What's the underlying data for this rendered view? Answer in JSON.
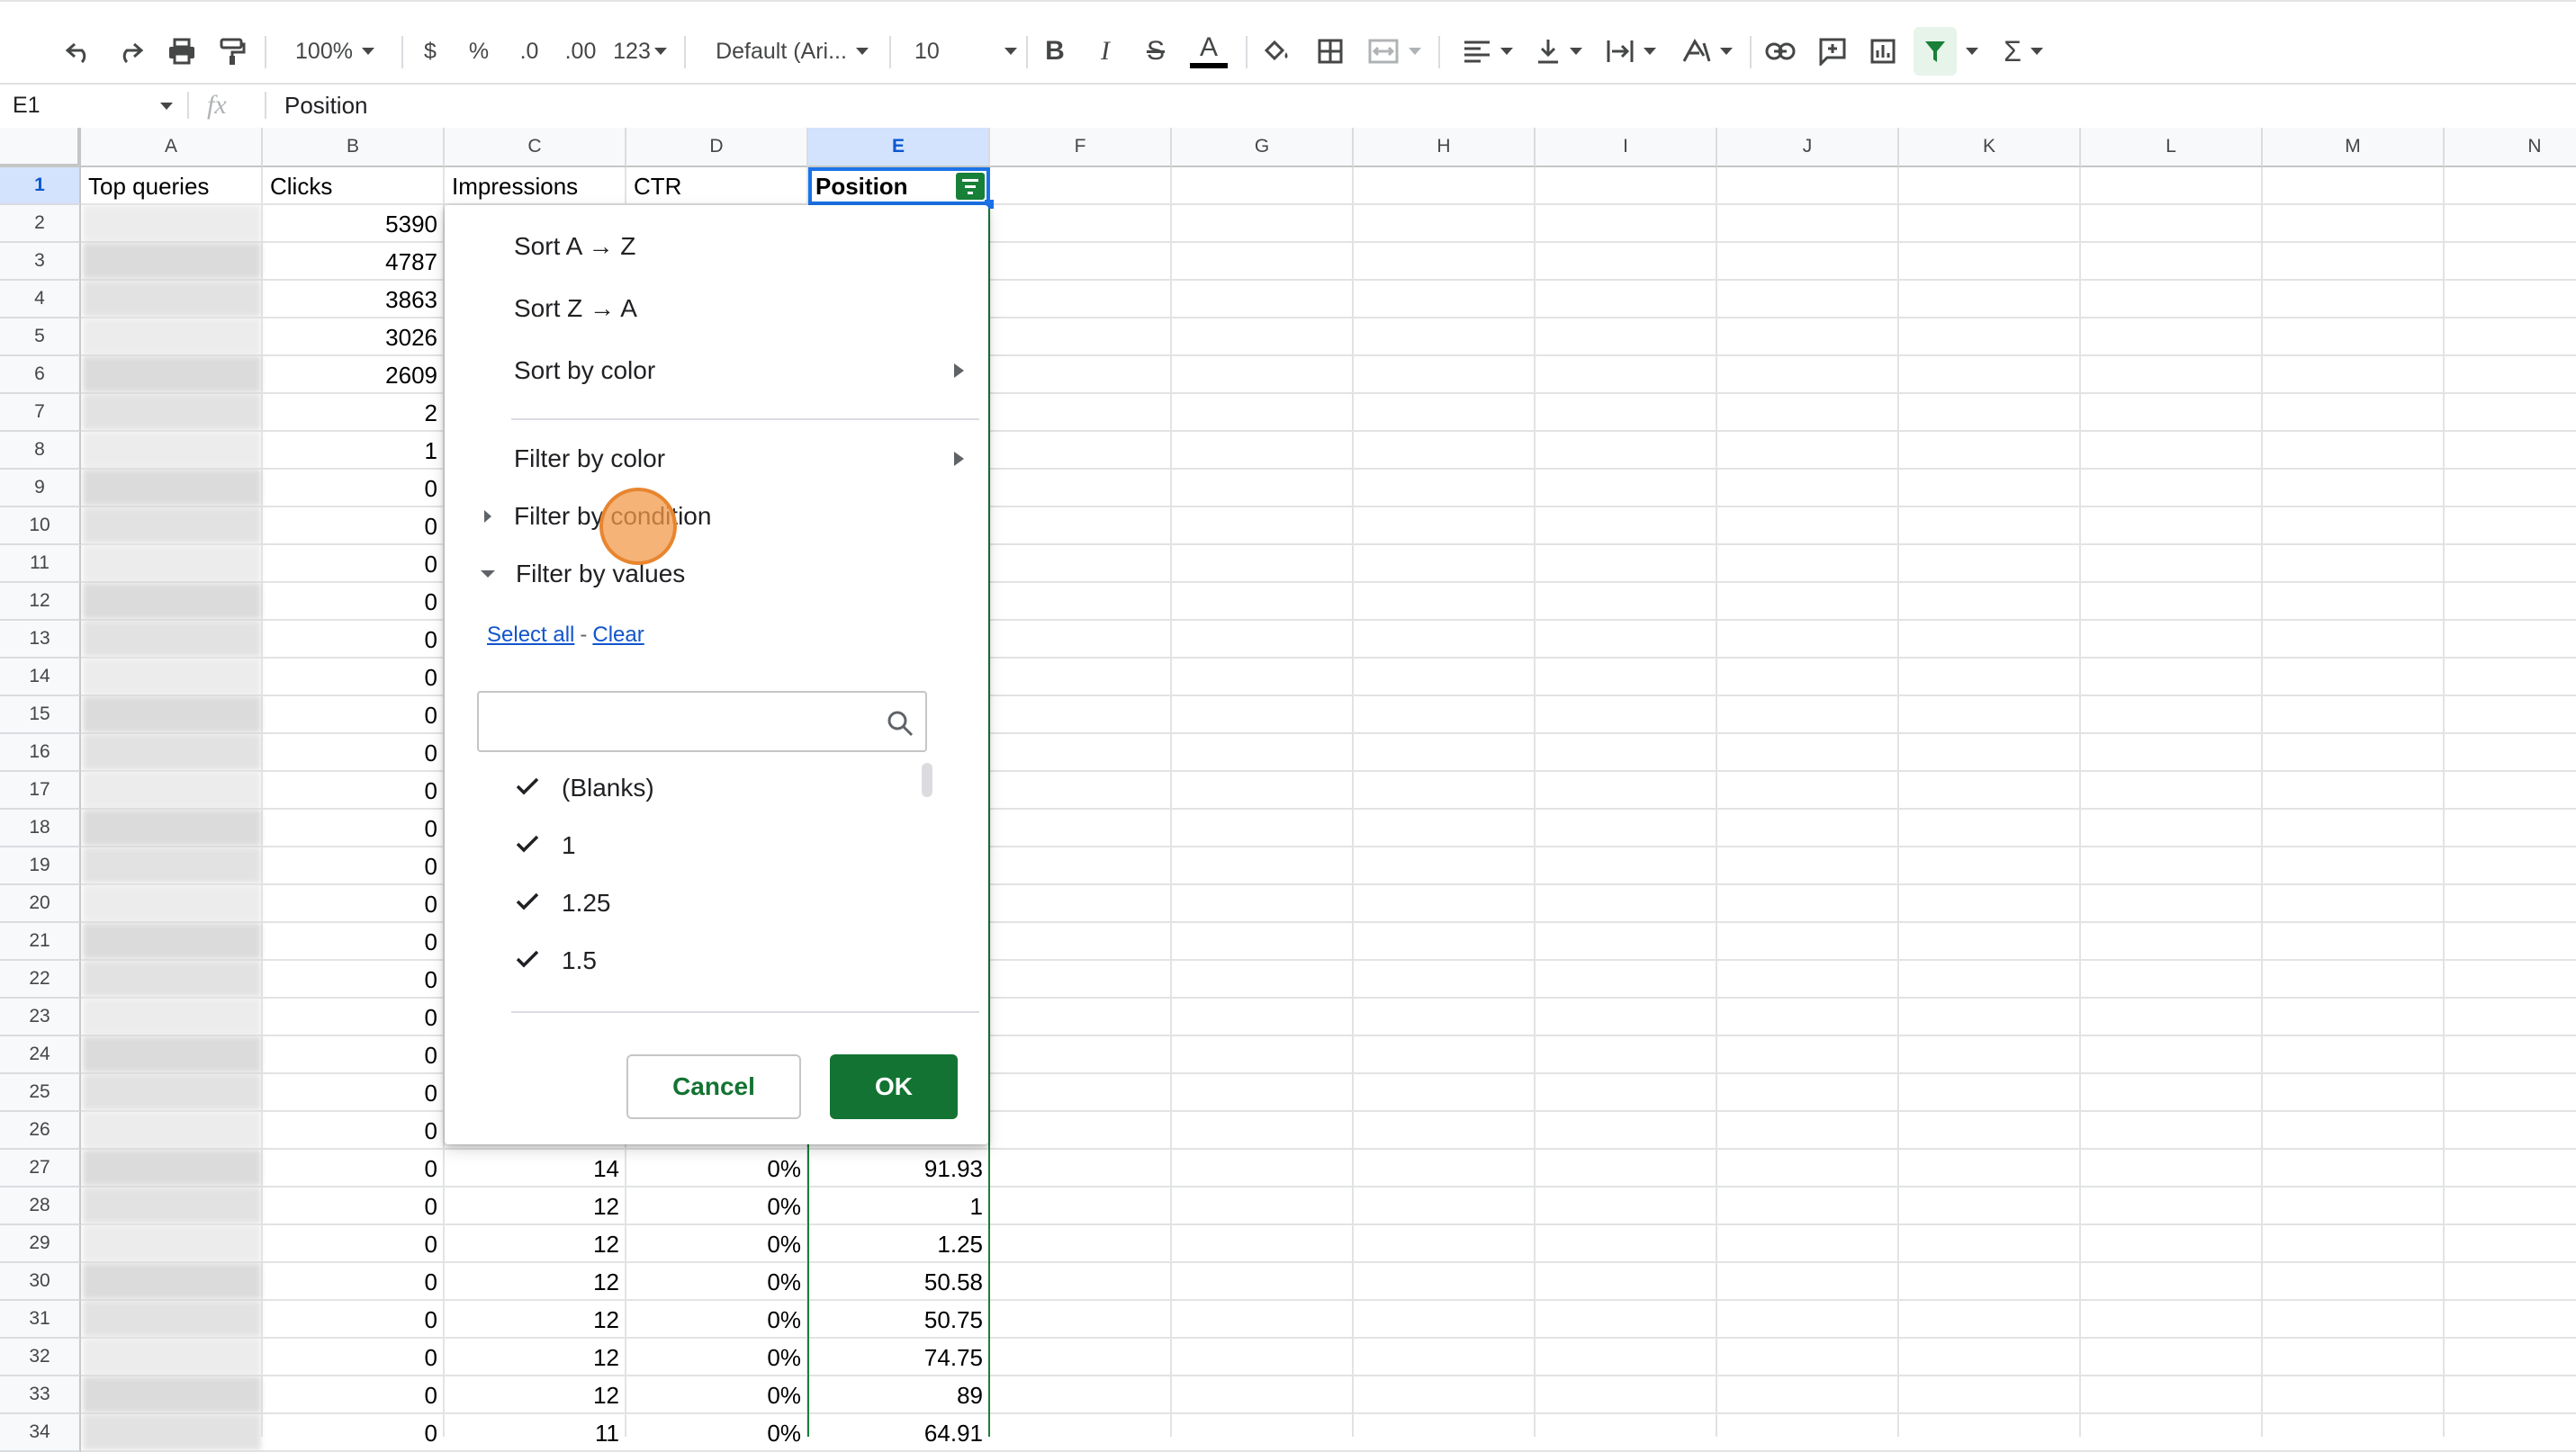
{
  "toolbar": {
    "zoom": "100%",
    "currency": "$",
    "percent": "%",
    "dec_decrease": ".0",
    "dec_increase": ".00",
    "format_more": "123",
    "font": "Default (Ari...",
    "font_size": "10",
    "bold": "B",
    "italic": "I",
    "strike": "S",
    "text_color": "A",
    "sum": "Σ"
  },
  "formula_bar": {
    "name_box": "E1",
    "fx": "fx",
    "content": "Position"
  },
  "columns": [
    "A",
    "B",
    "C",
    "D",
    "E",
    "F",
    "G",
    "H",
    "I",
    "J",
    "K",
    "L",
    "M",
    "N"
  ],
  "headers": {
    "a": "Top queries",
    "b": "Clicks",
    "c": "Impressions",
    "d": "CTR",
    "e": "Position"
  },
  "rows": [
    {
      "n": "1"
    },
    {
      "n": "2",
      "b": "5390"
    },
    {
      "n": "3",
      "b": "4787"
    },
    {
      "n": "4",
      "b": "3863"
    },
    {
      "n": "5",
      "b": "3026"
    },
    {
      "n": "6",
      "b": "2609"
    },
    {
      "n": "7",
      "b": "2"
    },
    {
      "n": "8",
      "b": "1"
    },
    {
      "n": "9",
      "b": "0"
    },
    {
      "n": "10",
      "b": "0"
    },
    {
      "n": "11",
      "b": "0"
    },
    {
      "n": "12",
      "b": "0"
    },
    {
      "n": "13",
      "b": "0"
    },
    {
      "n": "14",
      "b": "0"
    },
    {
      "n": "15",
      "b": "0"
    },
    {
      "n": "16",
      "b": "0"
    },
    {
      "n": "17",
      "b": "0"
    },
    {
      "n": "18",
      "b": "0"
    },
    {
      "n": "19",
      "b": "0"
    },
    {
      "n": "20",
      "b": "0"
    },
    {
      "n": "21",
      "b": "0"
    },
    {
      "n": "22",
      "b": "0"
    },
    {
      "n": "23",
      "b": "0"
    },
    {
      "n": "24",
      "b": "0"
    },
    {
      "n": "25",
      "b": "0"
    },
    {
      "n": "26",
      "b": "0"
    },
    {
      "n": "27",
      "b": "0",
      "c": "14",
      "d": "0%",
      "e": "91.93"
    },
    {
      "n": "28",
      "b": "0",
      "c": "12",
      "d": "0%",
      "e": "1"
    },
    {
      "n": "29",
      "b": "0",
      "c": "12",
      "d": "0%",
      "e": "1.25"
    },
    {
      "n": "30",
      "b": "0",
      "c": "12",
      "d": "0%",
      "e": "50.58"
    },
    {
      "n": "31",
      "b": "0",
      "c": "12",
      "d": "0%",
      "e": "50.75"
    },
    {
      "n": "32",
      "b": "0",
      "c": "12",
      "d": "0%",
      "e": "74.75"
    },
    {
      "n": "33",
      "b": "0",
      "c": "12",
      "d": "0%",
      "e": "89"
    },
    {
      "n": "34",
      "b": "0",
      "c": "11",
      "d": "0%",
      "e": "64.91"
    }
  ],
  "menu": {
    "sort_az": "Sort A → Z",
    "sort_za": "Sort Z → A",
    "sort_color": "Sort by color",
    "filter_color": "Filter by color",
    "filter_condition": "Filter by condition",
    "filter_values": "Filter by values",
    "select_all": "Select all",
    "dash": "-",
    "clear": "Clear",
    "search_placeholder": "",
    "values": [
      "(Blanks)",
      "1",
      "1.25",
      "1.5"
    ],
    "cancel": "Cancel",
    "ok": "OK"
  },
  "colors": {
    "accent_green": "#188038",
    "ok_button": "#137333",
    "link_blue": "#1155cc",
    "click_marker": "#f29a4a"
  }
}
